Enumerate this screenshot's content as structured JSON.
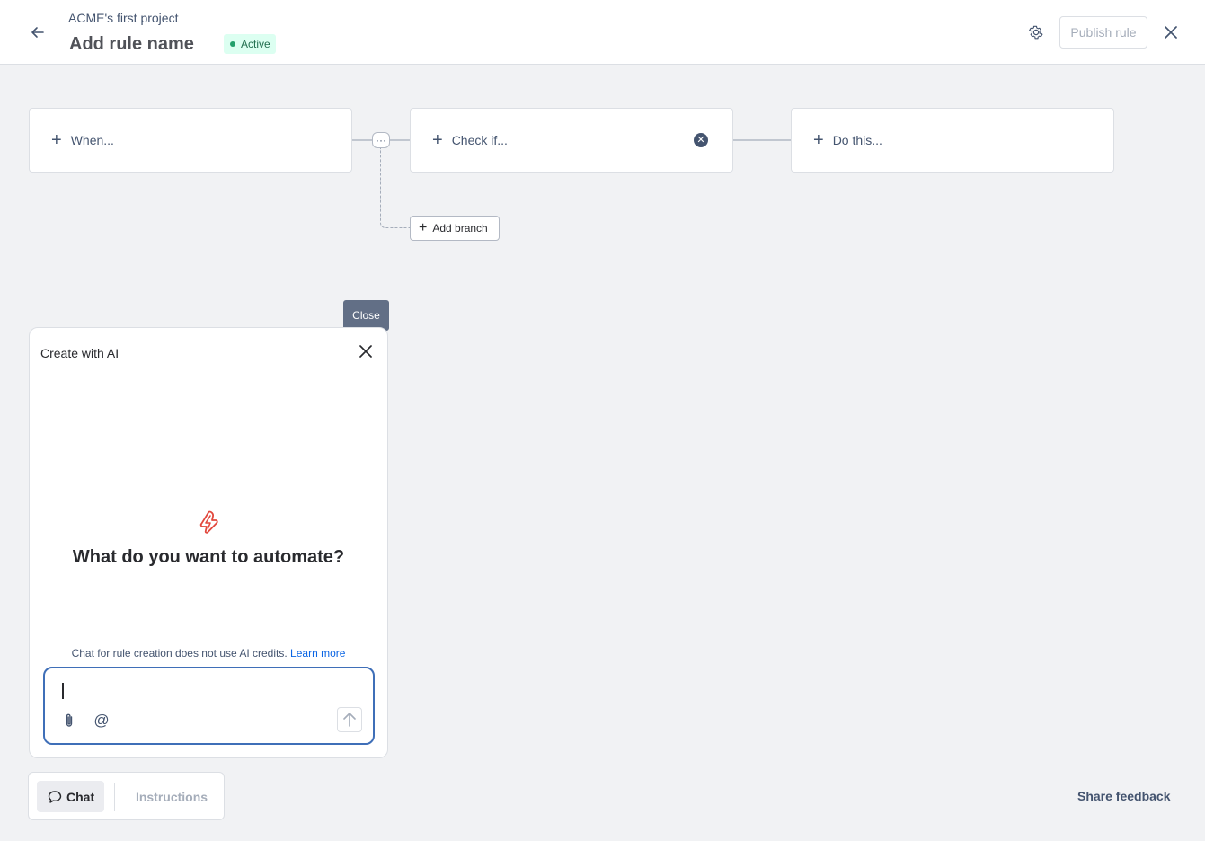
{
  "header": {
    "project_name": "ACME's first project",
    "rule_name": "Add rule name",
    "status": "Active",
    "publish_label": "Publish rule"
  },
  "flow": {
    "when_label": "When...",
    "check_label": "Check if...",
    "do_label": "Do this...",
    "dots": "···",
    "add_branch_label": "Add branch"
  },
  "tooltip": {
    "text": "Close"
  },
  "ai_panel": {
    "title": "Create with AI",
    "heading": "What do you want to automate?",
    "note": "Chat for rule creation does not use AI credits.",
    "learn_more": "Learn more",
    "input_value": ""
  },
  "tabs": {
    "chat_label": "Chat",
    "instructions_label": "Instructions"
  },
  "footer": {
    "share_feedback": "Share feedback"
  },
  "colors": {
    "accent": "#0c66e4",
    "status_green": "#22a06b",
    "bolt_red": "#e2483d",
    "input_border": "#3f6fb8"
  }
}
